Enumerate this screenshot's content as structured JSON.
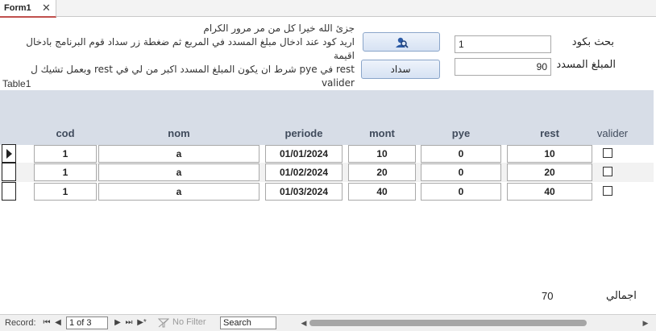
{
  "tab": {
    "title": "Form1",
    "close_glyph": "✕"
  },
  "note": {
    "text": "جزئ الله خيرا كل من مر مرور الكرام\nاريد كود  عند ادخال مبلغ المسدد في المربع  ثم ضغطة زر سداد قوم البرنامج بادخال اقيمة\nrest في pye شرط ان يكون المبلغ المسدد اكبر من لي في  rest وبعمل تشيك ل valider\nويمر الى الخانة الموالية  ونفس العملية يعني حلقة تكرارية  لادخل pye حسب المبلغ\nالمسدد"
  },
  "buttons": {
    "search_icon": "search-user-icon",
    "pay_label": "سداد"
  },
  "search": {
    "label": "بحث بكود",
    "value": "1"
  },
  "amount": {
    "label": "المبلغ المسدد",
    "value": "90"
  },
  "table": {
    "title": "Table1",
    "columns": [
      "cod",
      "nom",
      "periode",
      "mont",
      "pye",
      "rest",
      "valider"
    ],
    "rows": [
      {
        "cod": "1",
        "nom": "a",
        "periode": "01/01/2024",
        "mont": "10",
        "pye": "0",
        "rest": "10",
        "valider": false,
        "selected": true
      },
      {
        "cod": "1",
        "nom": "a",
        "periode": "01/02/2024",
        "mont": "20",
        "pye": "0",
        "rest": "20",
        "valider": false,
        "selected": false
      },
      {
        "cod": "1",
        "nom": "a",
        "periode": "01/03/2024",
        "mont": "40",
        "pye": "0",
        "rest": "40",
        "valider": false,
        "selected": false
      }
    ]
  },
  "total": {
    "label": "اجمالي",
    "value": "70"
  },
  "nav": {
    "record_label": "Record:",
    "position": "1 of 3",
    "first": "⏮",
    "prev": "◀",
    "next": "▶",
    "last": "⏭",
    "new": "▶*",
    "filter_label": "No Filter",
    "search_placeholder": "Search"
  },
  "colors": {
    "header_bg": "#d7dde7",
    "tab_accent": "#c0504d",
    "button_border": "#8aa5c9"
  }
}
